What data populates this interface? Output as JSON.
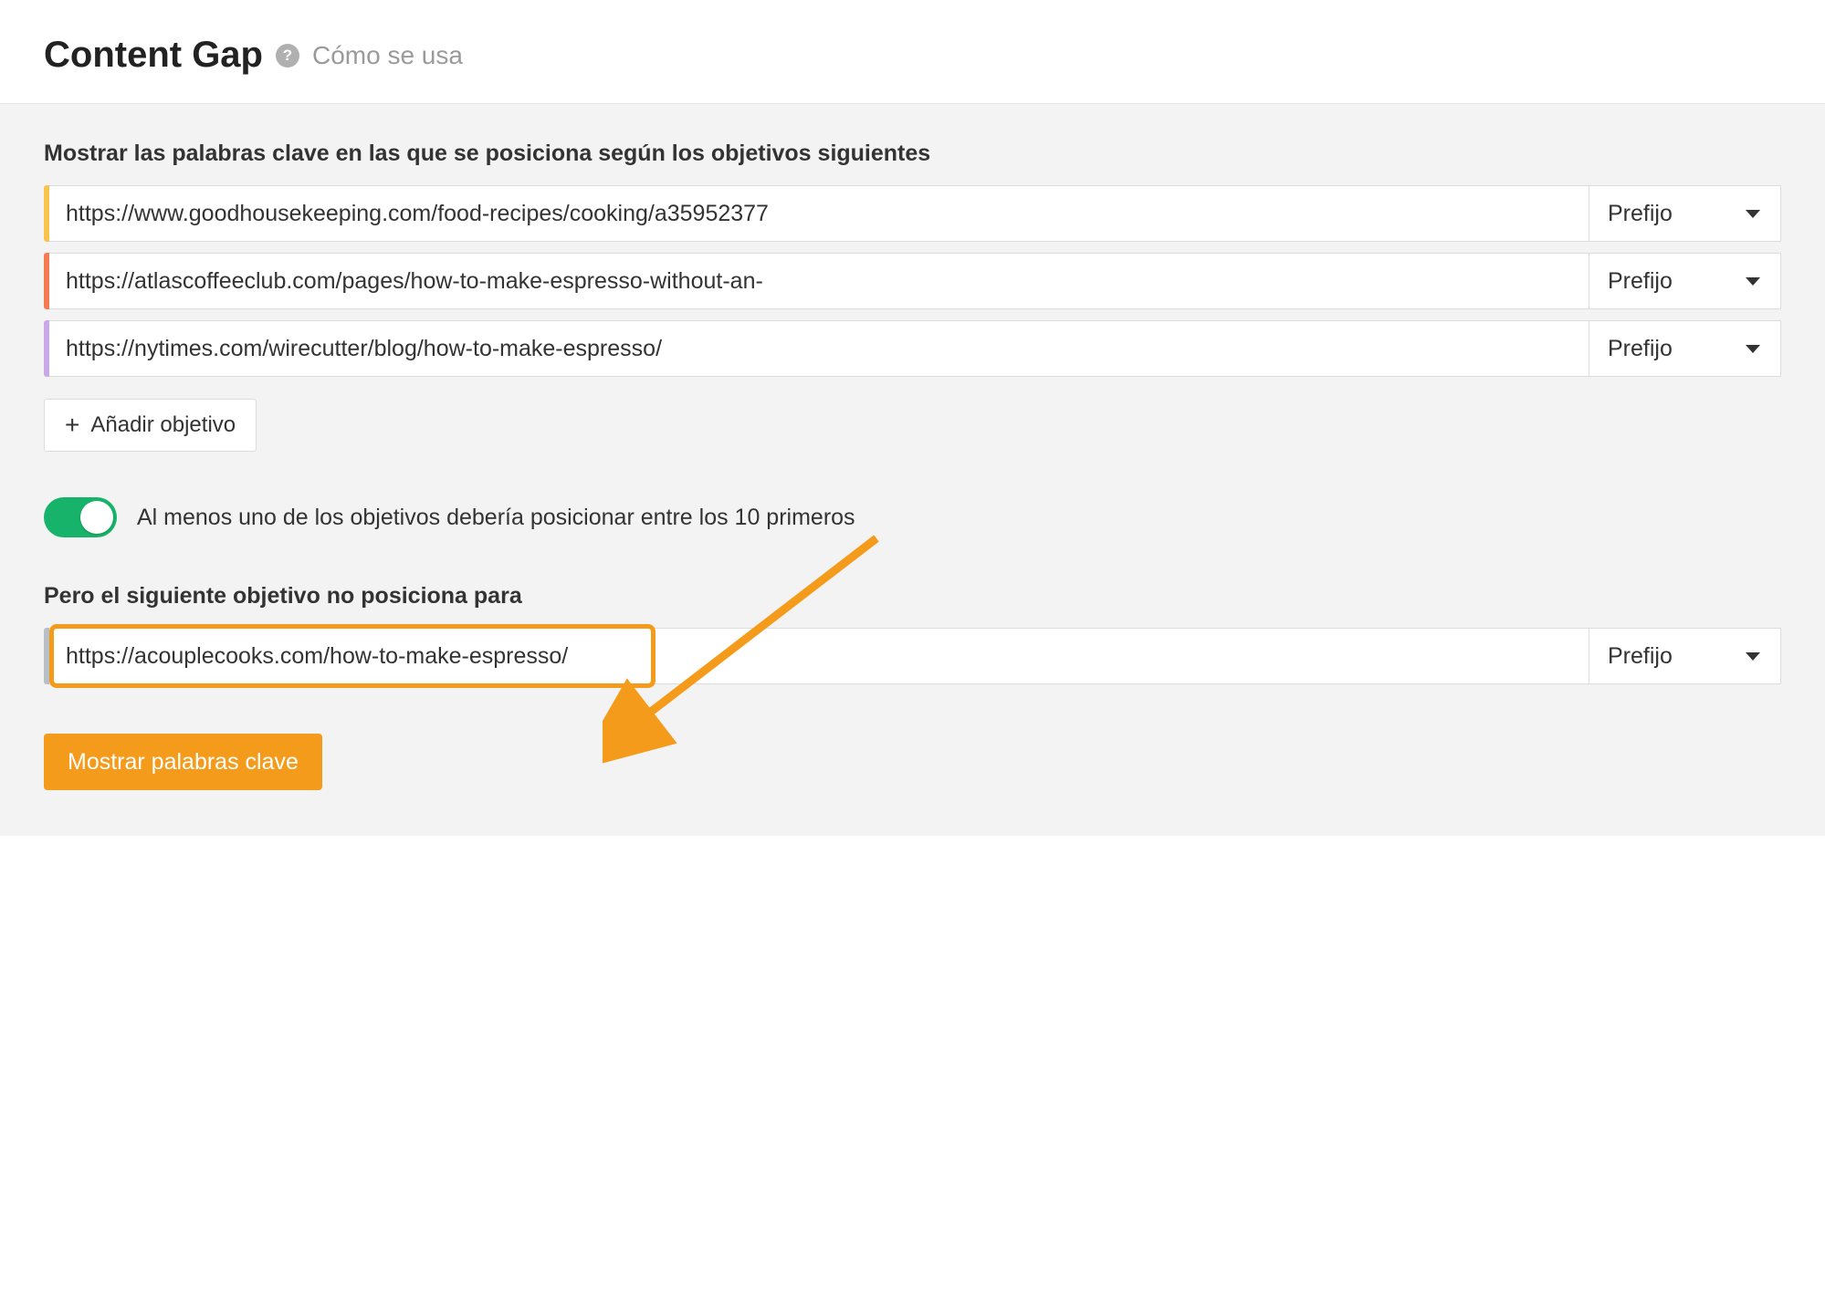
{
  "header": {
    "title": "Content Gap",
    "help_text": "Cómo se usa"
  },
  "targets": {
    "label": "Mostrar las palabras clave en las que se posiciona según los objetivos siguientes",
    "rows": [
      {
        "url": "https://www.goodhousekeeping.com/food-recipes/cooking/a35952377",
        "mode": "Prefijo"
      },
      {
        "url": "https://atlascoffeeclub.com/pages/how-to-make-espresso-without-an-",
        "mode": "Prefijo"
      },
      {
        "url": "https://nytimes.com/wirecutter/blog/how-to-make-espresso/",
        "mode": "Prefijo"
      }
    ],
    "add_label": "Añadir objetivo"
  },
  "toggle": {
    "label": "Al menos uno de los objetivos debería posicionar entre los 10 primeros",
    "on": true
  },
  "exclude": {
    "label": "Pero el siguiente objetivo no posiciona para",
    "url": "https://acouplecooks.com/how-to-make-espresso/",
    "mode": "Prefijo"
  },
  "submit_label": "Mostrar palabras clave"
}
